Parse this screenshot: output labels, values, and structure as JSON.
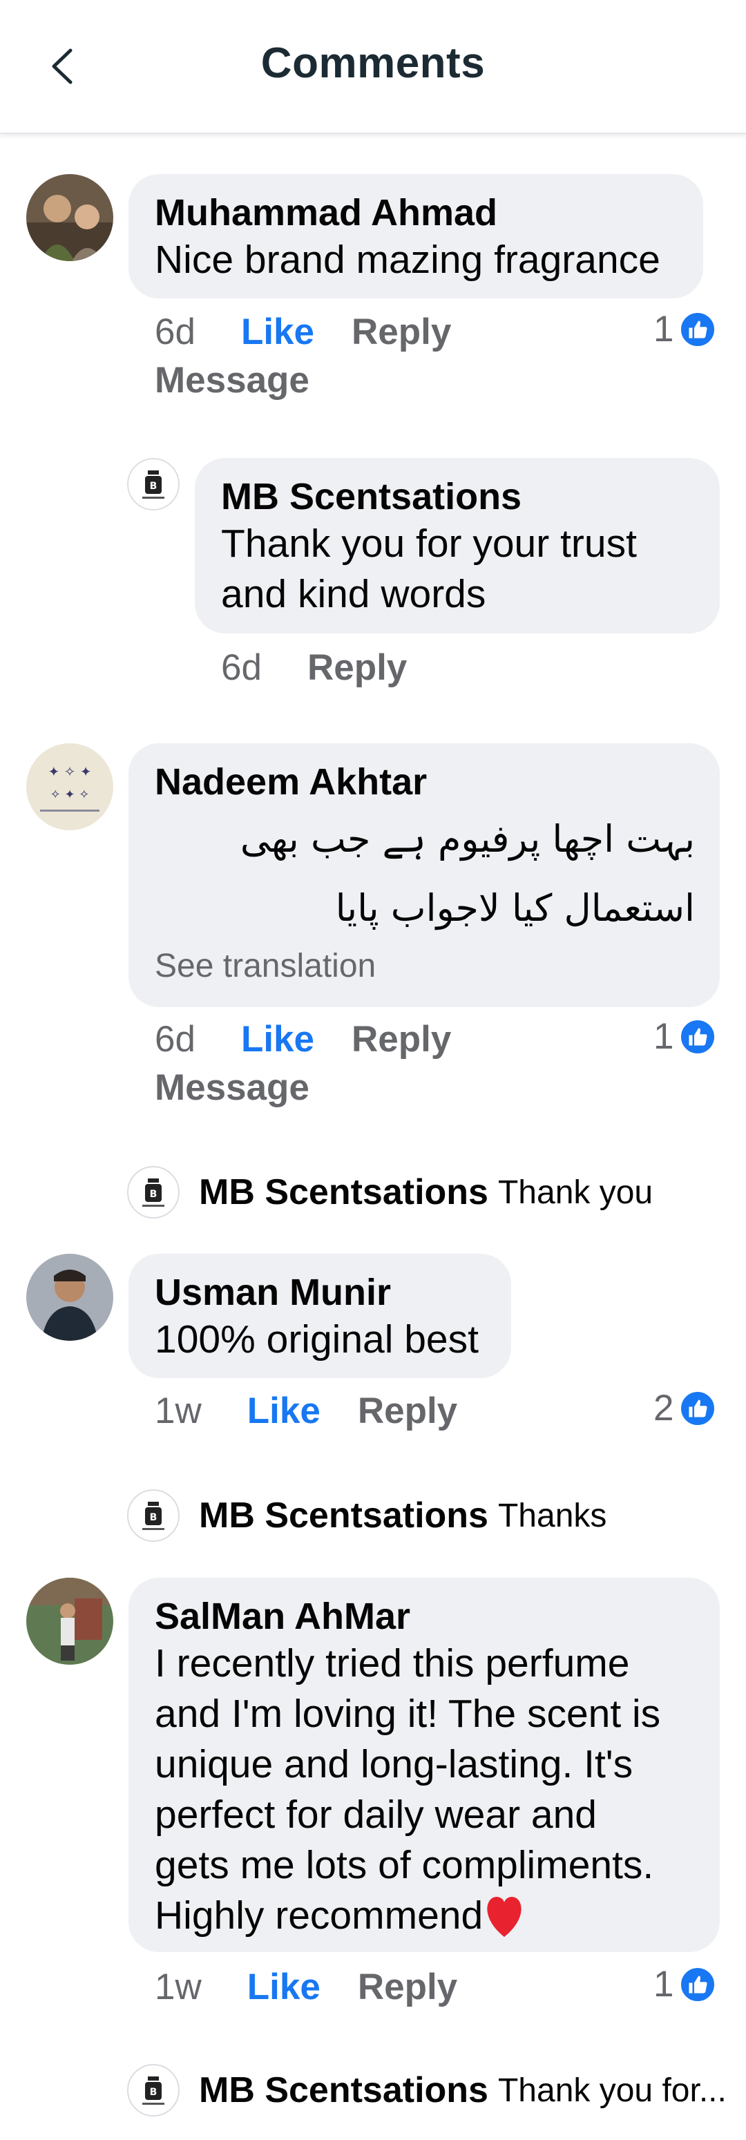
{
  "header": {
    "title": "Comments",
    "back_icon": "chevron-left-icon"
  },
  "comments": [
    {
      "author": "Muhammad Ahmad",
      "text": "Nice brand mazing fragrance",
      "time": "6d",
      "like": "Like",
      "reply": "Reply",
      "message": "Message",
      "reactions": "1",
      "page_reply": {
        "author": "MB Scentsations",
        "text_line1": "Thank you for your trust",
        "text_line2": "and kind words",
        "time": "6d",
        "reply": "Reply"
      }
    },
    {
      "author": "Nadeem Akhtar",
      "text_line1": "بہت اچھا پرفیوم ہے جب بھی",
      "text_line2": "استعمال کیا لاجواب پایا",
      "see_translation": "See translation",
      "time": "6d",
      "like": "Like",
      "reply": "Reply",
      "message": "Message",
      "reactions": "1",
      "page_reply": {
        "author": "MB Scentsations",
        "text": "Thank you"
      }
    },
    {
      "author": "Usman Munir",
      "text": "100% original best",
      "time": "1w",
      "like": "Like",
      "reply": "Reply",
      "reactions": "2",
      "page_reply": {
        "author": "MB Scentsations",
        "text": "Thanks"
      }
    },
    {
      "author": "SalMan AhMar",
      "lines": [
        "I recently tried this perfume",
        "and I'm loving it! The scent is",
        "unique and long-lasting. It's",
        "perfect for daily wear and",
        "gets me lots of compliments.",
        "Highly recommend"
      ],
      "time": "1w",
      "like": "Like",
      "reply": "Reply",
      "reactions": "1",
      "page_reply": {
        "author": "MB Scentsations",
        "text": "Thank you for..."
      }
    }
  ],
  "colors": {
    "accent": "#1877f2",
    "bubble": "#eff0f3",
    "muted": "#65676b"
  }
}
